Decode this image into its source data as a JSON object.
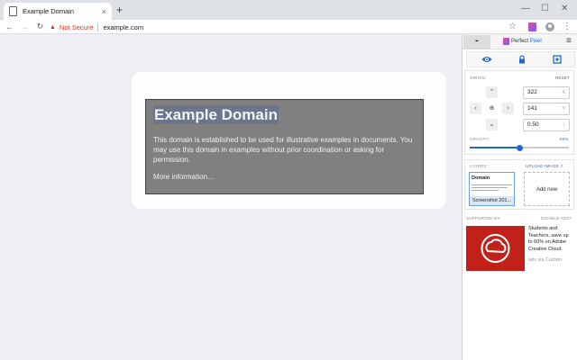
{
  "browser": {
    "tab_title": "Example Domain",
    "tab_close": "×",
    "new_tab": "+",
    "window_minimize": "—",
    "window_maximize": "☐",
    "window_close": "✕",
    "nav_back": "←",
    "nav_forward": "→",
    "nav_reload": "↻",
    "security_warning": "▲",
    "not_secure": "Not Secure",
    "url": "example.com",
    "bookmark_star": "☆",
    "menu": "⋮"
  },
  "page": {
    "title": "Example Domain",
    "paragraph": "This domain is established to be used for illustrative examples in documents. You may use this domain in examples without prior coordination or asking for permission.",
    "link": "More information..."
  },
  "perfect_pixel": {
    "minimize": "-",
    "title_prefix": "Perfect ",
    "title_suffix": "Pixel",
    "menu": "≡",
    "origin_label": "ORIGIN:",
    "reset_label": "RESET",
    "arrow_up": "⌃",
    "arrow_down": "⌄",
    "arrow_left": "‹",
    "arrow_right": "›",
    "center": "⊕",
    "x_value": "322",
    "x_unit": "X",
    "y_value": "141",
    "y_unit": "Y",
    "scale_value": "0.50",
    "scale_unit": "↕",
    "opacity_label": "OPACITY:",
    "opacity_value": "50%",
    "opacity_fraction": 0.5,
    "layers_label": "LAYERS:",
    "upload_label": "UPLOAD IMAGE",
    "upload_icon": "⇧",
    "layer_thumb_title": "Domain",
    "layer_name": "Screenshot 201...",
    "add_new": "Add new",
    "supported_by": "SUPPORTED BY:",
    "disable_ads": "DISABLE ADS?",
    "ad_text": "Students and Teachers, save up to 60% on Adobe Creative Cloud.",
    "ad_via": "ads via Carbon",
    "accent_color": "#1e6ad2",
    "ad_color": "#c2211a"
  }
}
